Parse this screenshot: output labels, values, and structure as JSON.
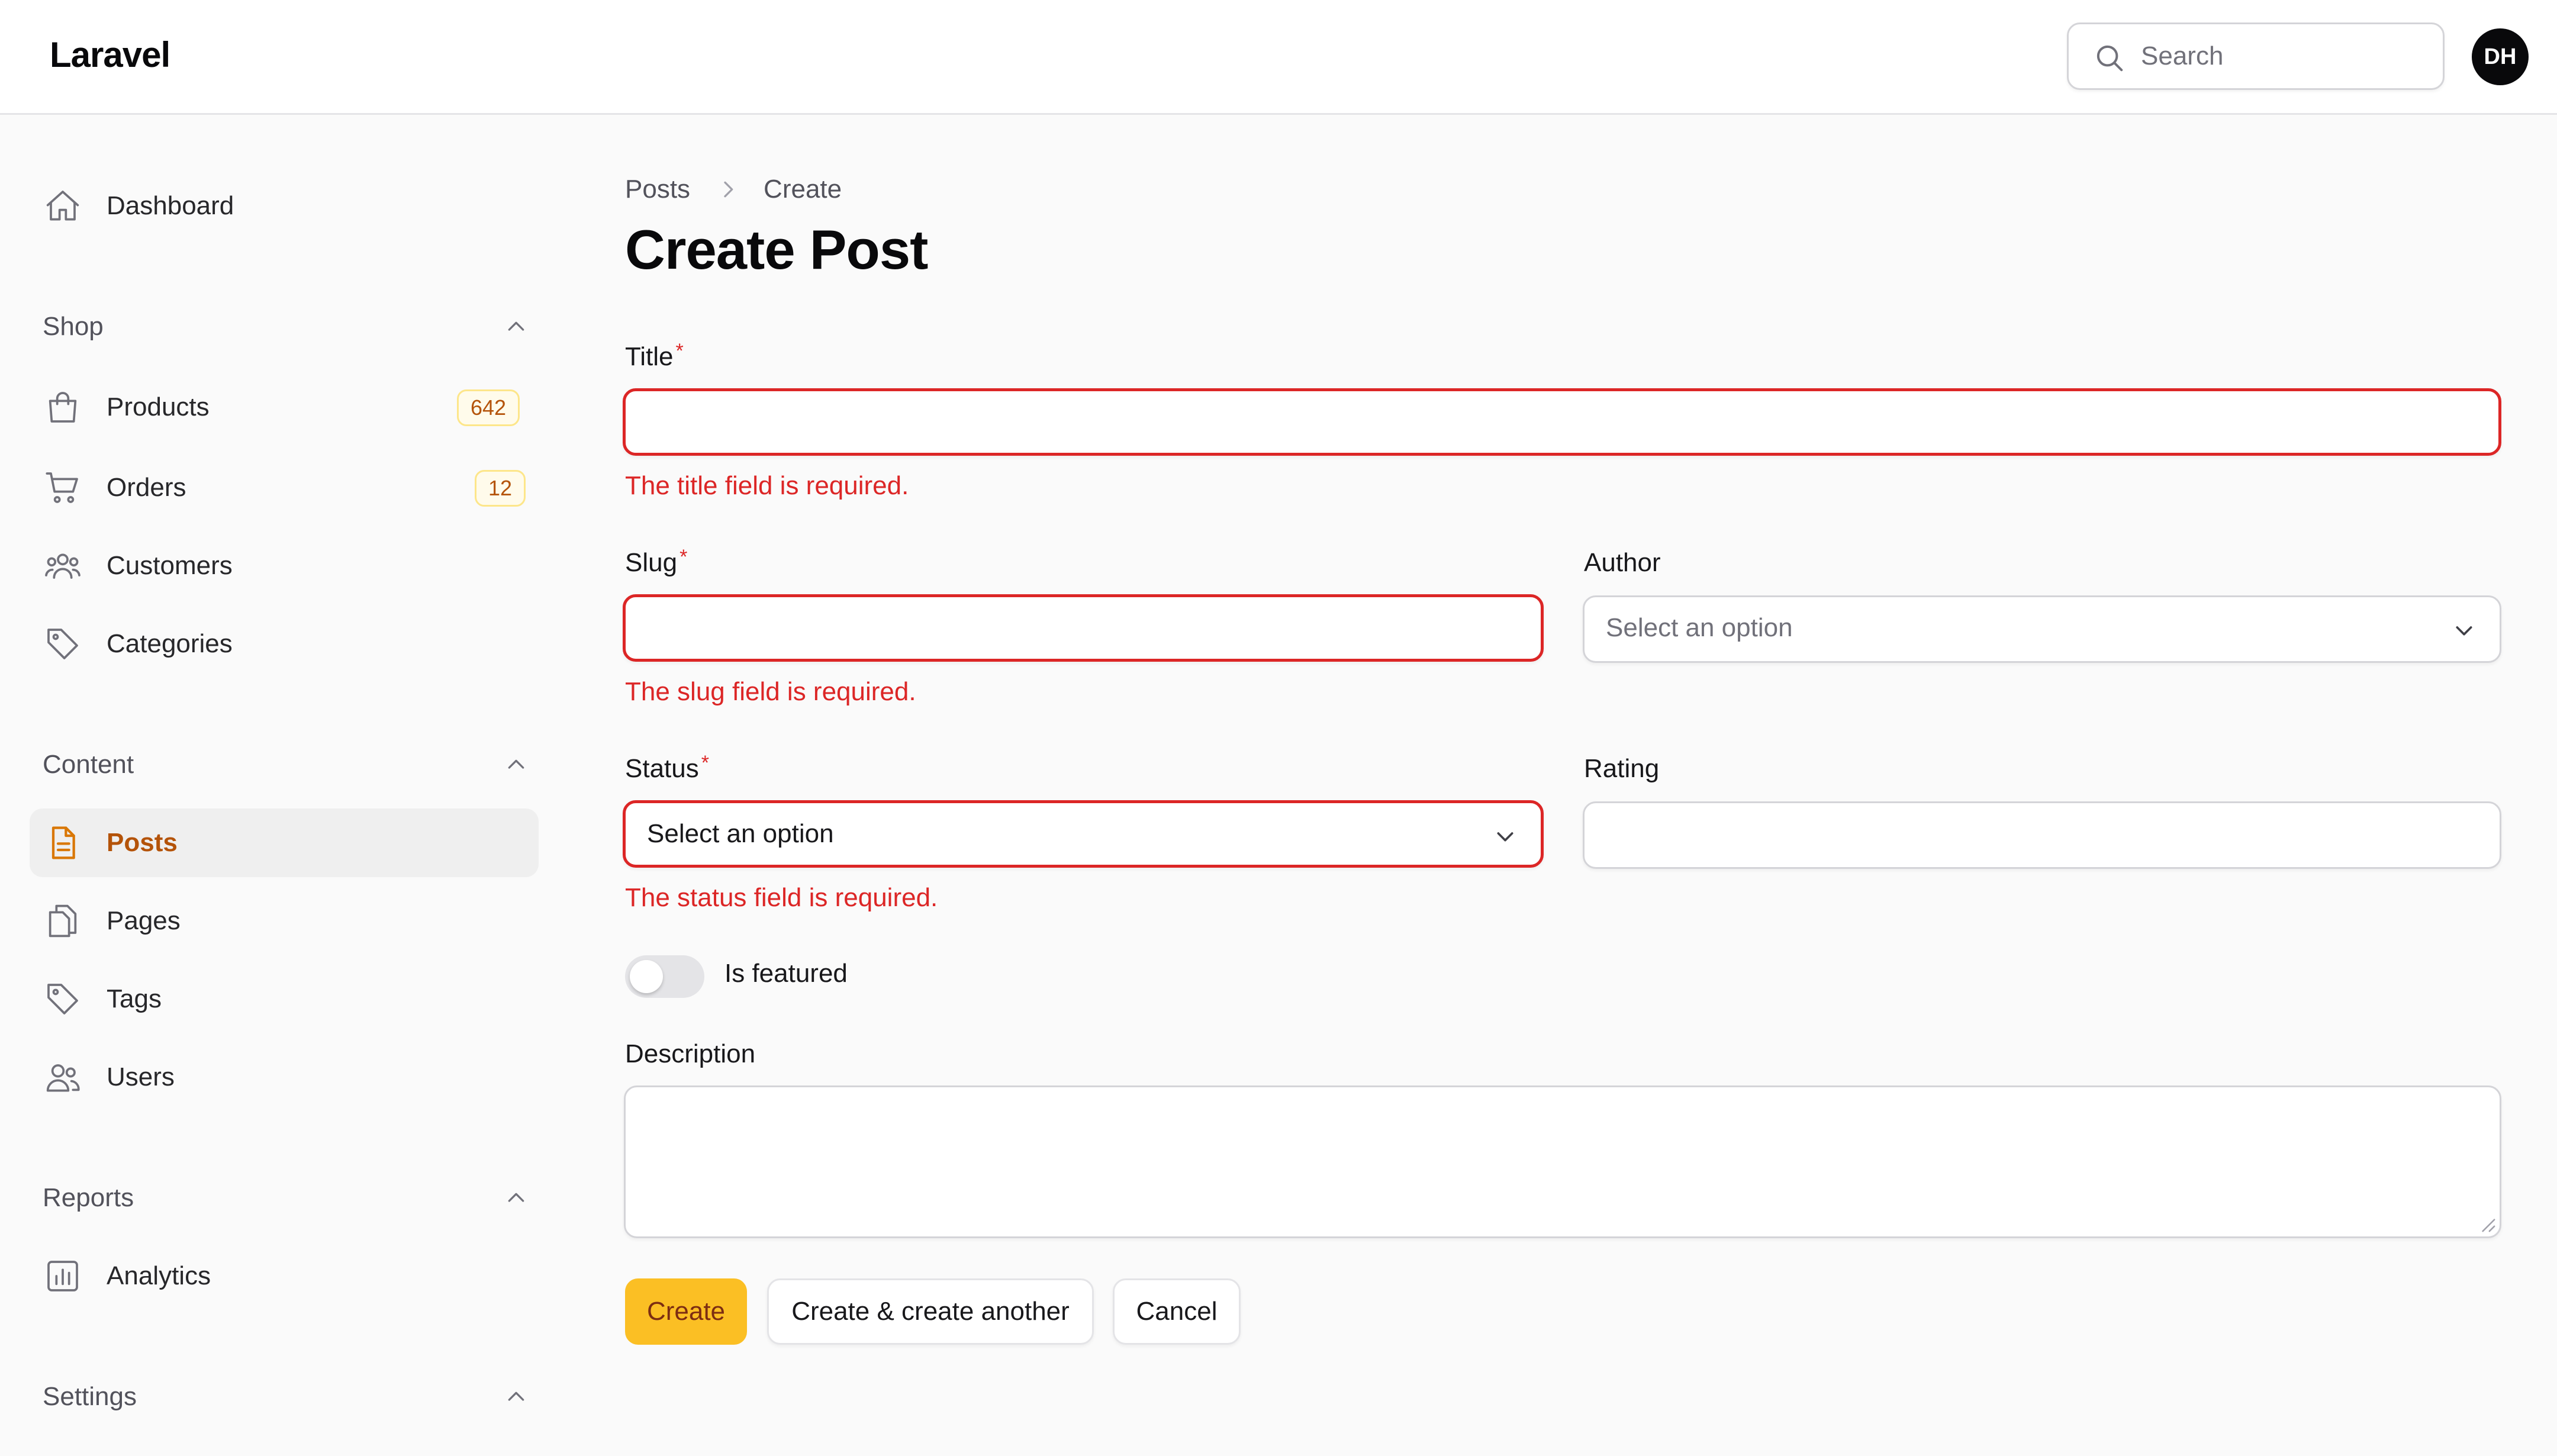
{
  "topbar": {
    "brand": "Laravel",
    "search_placeholder": "Search",
    "avatar_initials": "DH"
  },
  "sidebar": {
    "dashboard": {
      "label": "Dashboard",
      "icon": "home-icon"
    },
    "groups": {
      "shop": {
        "label": "Shop",
        "items": [
          {
            "label": "Products",
            "icon": "shopping-bag-icon",
            "badge": "642"
          },
          {
            "label": "Orders",
            "icon": "shopping-cart-icon",
            "badge": "12"
          },
          {
            "label": "Customers",
            "icon": "user-group-icon"
          },
          {
            "label": "Categories",
            "icon": "tag-icon"
          }
        ]
      },
      "content": {
        "label": "Content",
        "items": [
          {
            "label": "Posts",
            "icon": "document-text-icon",
            "active": true
          },
          {
            "label": "Pages",
            "icon": "document-duplicate-icon"
          },
          {
            "label": "Tags",
            "icon": "tag-icon"
          },
          {
            "label": "Users",
            "icon": "users-icon"
          }
        ]
      },
      "reports": {
        "label": "Reports",
        "items": [
          {
            "label": "Analytics",
            "icon": "chart-bar-icon"
          }
        ]
      },
      "settings": {
        "label": "Settings"
      }
    }
  },
  "breadcrumb": {
    "posts": "Posts",
    "create": "Create"
  },
  "page_title": "Create Post",
  "form": {
    "title": {
      "label": "Title",
      "required_mark": "*",
      "value": "",
      "error": "The title field is required."
    },
    "slug": {
      "label": "Slug",
      "required_mark": "*",
      "value": "",
      "error": "The slug field is required."
    },
    "author": {
      "label": "Author",
      "placeholder": "Select an option"
    },
    "status": {
      "label": "Status",
      "required_mark": "*",
      "value": "Select an option",
      "error": "The status field is required."
    },
    "rating": {
      "label": "Rating",
      "value": ""
    },
    "is_featured": {
      "label": "Is featured",
      "on": false
    },
    "description": {
      "label": "Description",
      "value": ""
    }
  },
  "actions": {
    "create": "Create",
    "create_another": "Create & create another",
    "cancel": "Cancel"
  },
  "colors": {
    "accent": "#fbbf24",
    "active_text": "#b45309",
    "error": "#dc2626"
  }
}
